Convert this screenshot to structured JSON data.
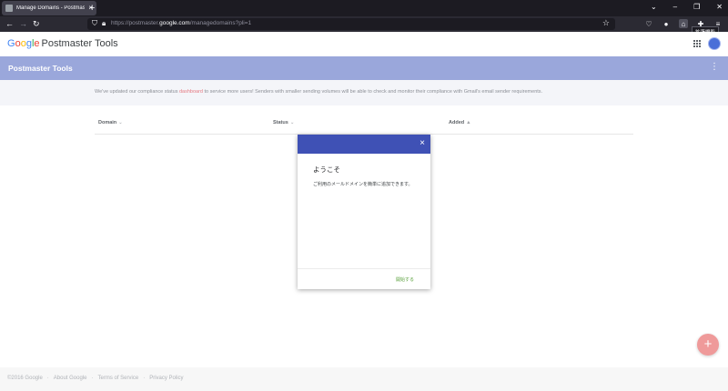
{
  "browser": {
    "tab_title": "Manage Domains - Postmaster",
    "tab_close": "×",
    "new_tab": "+",
    "url_prefix": "https://postmaster.",
    "url_domain": "google.com",
    "url_suffix": "/managedomains?pli=1",
    "tooltip": "拡張機能",
    "icons": [
      "back-arrow-icon",
      "forward-arrow-icon",
      "reload-icon",
      "shield-icon",
      "lock-icon",
      "star-icon",
      "pocket-icon",
      "account-icon",
      "home-icon",
      "extensions-icon",
      "menu-icon"
    ]
  },
  "header": {
    "logo_g": "G",
    "logo_o1": "o",
    "logo_o2": "o",
    "logo_g2": "g",
    "logo_l": "l",
    "logo_e": "e",
    "product": "Postmaster Tools"
  },
  "titlebar": {
    "title": "Postmaster Tools"
  },
  "notice": {
    "before": "We've updated our compliance status ",
    "link": "dashboard",
    "after": " to service more users! Senders with smaller sending volumes will be able to check and monitor their compliance with Gmail's email sender requirements."
  },
  "table": {
    "columns": [
      {
        "label": "Domain",
        "sort": "⌄"
      },
      {
        "label": "Status",
        "sort": "⌄"
      },
      {
        "label": "Added",
        "sort": "▲"
      }
    ]
  },
  "modal": {
    "close": "×",
    "title": "ようこそ",
    "body": "ご利用のメールドメインを簡単に追加できます。",
    "action": "開始する"
  },
  "fab": {
    "label": "+"
  },
  "footer": {
    "links": [
      "©2016 Google",
      "About Google",
      "Terms of Service",
      "Privacy Policy"
    ],
    "separator": "·"
  }
}
